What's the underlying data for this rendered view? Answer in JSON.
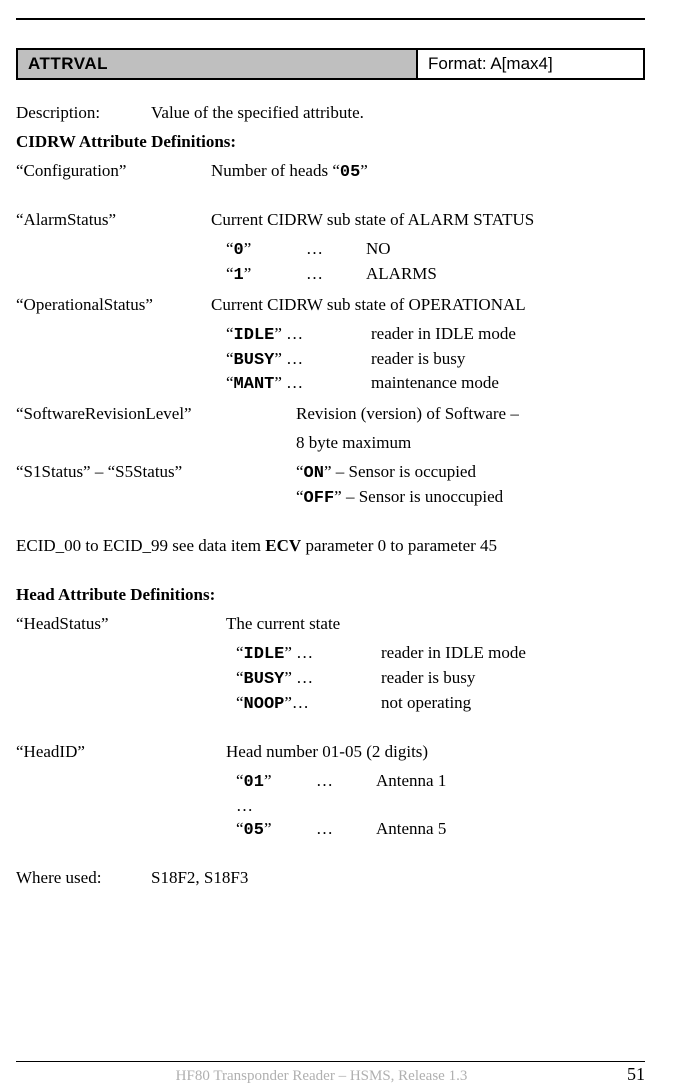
{
  "header": {
    "title": "ATTRVAL",
    "format": "Format: A[max4]"
  },
  "description": {
    "label": "Description:",
    "text": "Value of the specified attribute."
  },
  "cidrw_heading": "CIDRW Attribute Definitions:",
  "config": {
    "name": "“Configuration”",
    "desc_pre": "Number of heads “",
    "desc_code": "05",
    "desc_post": "”"
  },
  "alarm": {
    "name": "“AlarmStatus”",
    "desc": "Current CIDRW sub state of ALARM STATUS",
    "rows": [
      {
        "code": "0",
        "dots": "…",
        "text": "NO"
      },
      {
        "code": "1",
        "dots": "…",
        "text": "ALARMS"
      }
    ]
  },
  "oper": {
    "name": "“OperationalStatus”",
    "desc": "Current CIDRW sub state of OPERATIONAL",
    "rows": [
      {
        "code": "IDLE",
        "dots": "…",
        "text": "reader in IDLE mode"
      },
      {
        "code": "BUSY",
        "dots": "…",
        "text": "reader is busy"
      },
      {
        "code": "MANT",
        "dots": "…",
        "text": "maintenance mode"
      }
    ]
  },
  "swrev": {
    "name": "“SoftwareRevisionLevel”",
    "line1": "Revision (version) of Software –",
    "line2": "8 byte maximum"
  },
  "sstatus": {
    "name": "“S1Status” – “S5Status”",
    "rows": [
      {
        "code": "ON",
        "text": "  – Sensor is occupied"
      },
      {
        "code": "OFF",
        "text": " – Sensor is unoccupied"
      }
    ]
  },
  "ecid": {
    "pre": "ECID_00 to ECID_99 see data item ",
    "bold": "ECV",
    "post": "  parameter 0 to parameter 45"
  },
  "head_heading": "Head Attribute Definitions:",
  "headstatus": {
    "name": "“HeadStatus”",
    "desc": "The current state",
    "rows": [
      {
        "code": "IDLE",
        "dots": "…",
        "text": "reader in IDLE mode"
      },
      {
        "code": "BUSY",
        "dots": "…",
        "text": "reader is busy"
      },
      {
        "code": "NOOP",
        "dots": "…",
        "text": "not operating"
      }
    ]
  },
  "headid": {
    "name": "“HeadID”",
    "desc": "Head number 01-05 (2 digits)",
    "rows": [
      {
        "code": "01",
        "dots": "…",
        "text": "Antenna 1"
      },
      {
        "code_plain": "…",
        "dots": "",
        "text": ""
      },
      {
        "code": "05",
        "dots": "…",
        "text": "Antenna 5"
      }
    ]
  },
  "where": {
    "label": "Where used:",
    "text": "S18F2, S18F3"
  },
  "footer": {
    "center": "HF80 Transponder Reader – HSMS, Release 1.3",
    "page": "51"
  }
}
